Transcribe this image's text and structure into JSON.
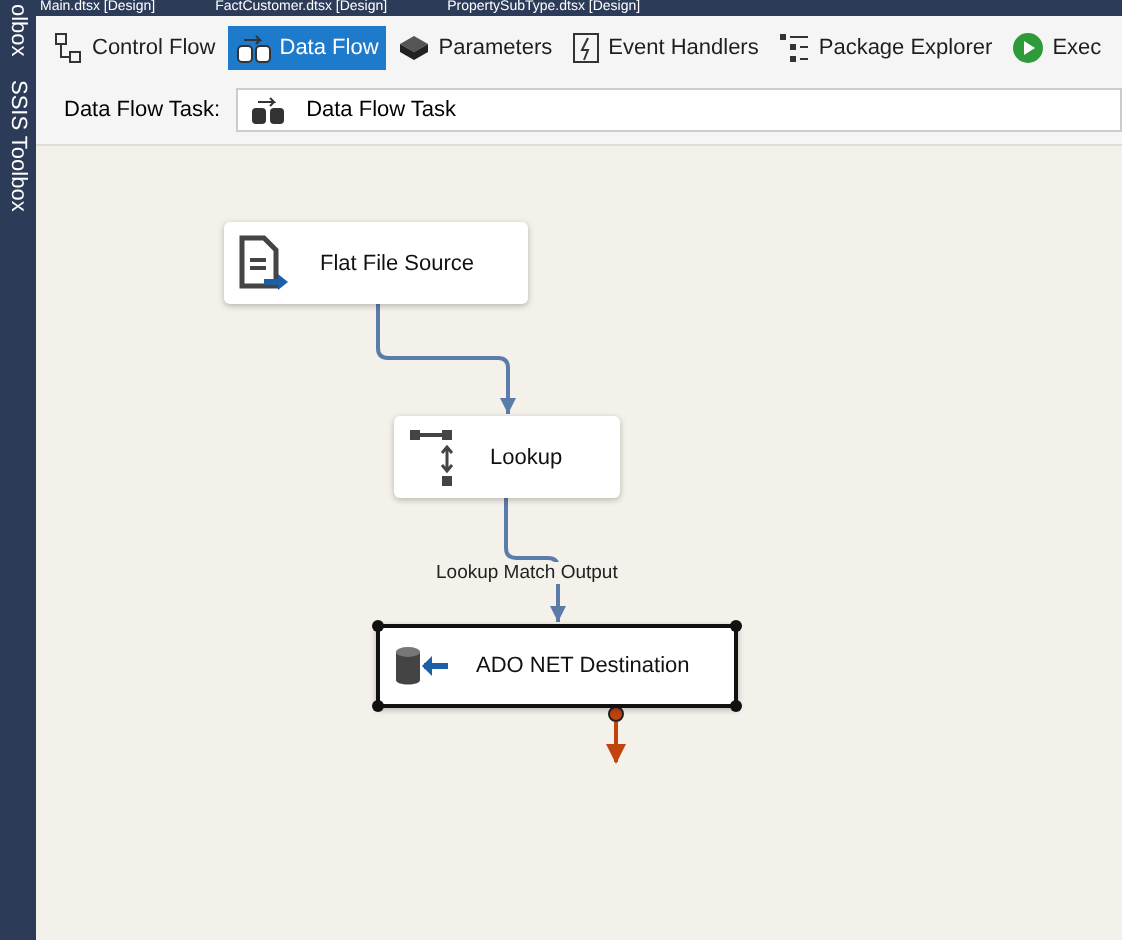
{
  "document_tabs": [
    {
      "label": "Main.dtsx [Design]"
    },
    {
      "label": "FactCustomer.dtsx [Design]"
    },
    {
      "label": "PropertySubType.dtsx [Design]"
    }
  ],
  "side_panel": {
    "labels": [
      "olbox",
      "SSIS Toolbox"
    ]
  },
  "designer_tabs": [
    {
      "label": "Control Flow",
      "kind": "control",
      "selected": false
    },
    {
      "label": "Data Flow",
      "kind": "dataflow",
      "selected": true
    },
    {
      "label": "Parameters",
      "kind": "params",
      "selected": false
    },
    {
      "label": "Event Handlers",
      "kind": "events",
      "selected": false
    },
    {
      "label": "Package Explorer",
      "kind": "explorer",
      "selected": false
    },
    {
      "label": "Exec",
      "kind": "execute",
      "selected": false
    }
  ],
  "task_selector": {
    "label": "Data Flow Task:",
    "value": "Data Flow Task"
  },
  "components": [
    {
      "name": "Flat File Source",
      "kind": "source",
      "selected": false
    },
    {
      "name": "Lookup",
      "kind": "lookup",
      "selected": false
    },
    {
      "name": "ADO NET Destination",
      "kind": "destination",
      "selected": true
    }
  ],
  "path_label": "Lookup Match Output"
}
